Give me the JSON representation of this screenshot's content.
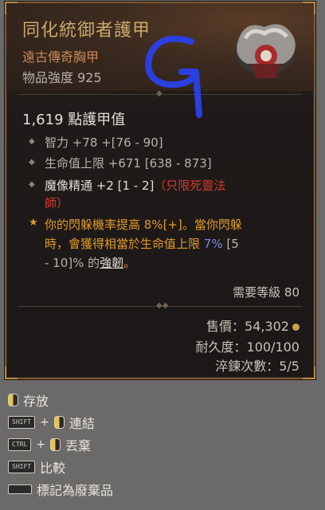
{
  "tooltip": {
    "title": "同化統御者護甲",
    "item_type": "遠古傳奇胸甲",
    "item_power": "物品強度 925",
    "armor": "1,619 點護甲值",
    "stats": [
      {
        "text": "智力 +78 +[76 - 90]"
      },
      {
        "text": "生命值上限 +671 [638 - 873]"
      }
    ],
    "skill_stat": {
      "main": "魔像精通 +2 [1 - 2]",
      "restriction_a": "（只限死靈法",
      "restriction_b": "師）"
    },
    "aspect": {
      "line1": "你的閃躲機率提高 8%[+]。當你閃躲",
      "line2_a": "時，會獲得相當於生命值上限 ",
      "line2_b": "7%",
      "line2_c": " [5",
      "line3_a": "- 10]% 的",
      "line3_b": "強韌",
      "line3_c": "。"
    },
    "required_level": "需要等級 80",
    "sell_value": "售價：54,302",
    "durability": "耐久度：100/100",
    "temper": "淬鍊次數：5/5"
  },
  "actions": [
    {
      "label": "存放"
    },
    {
      "label": "連結",
      "key": "SHIFT"
    },
    {
      "label": "丟棄",
      "key": "CTRL"
    },
    {
      "label": "比較",
      "key": "SHIFT"
    },
    {
      "label": "標記為廢棄品"
    }
  ],
  "annotation": {
    "letter": "G"
  },
  "colors": {
    "title": "#c9a96b",
    "aspect": "#e09a2a",
    "restriction": "#d43a2a",
    "highlight": "#7a8ae8"
  }
}
